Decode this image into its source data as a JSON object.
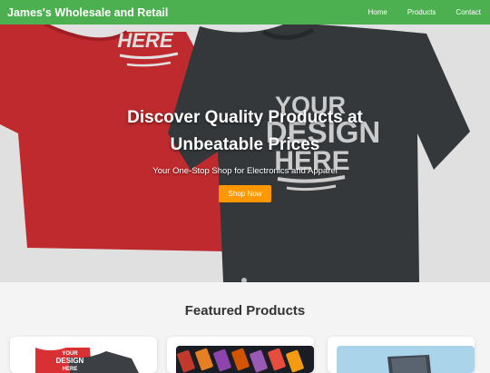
{
  "brand": "James's Wholesale and Retail",
  "nav": [
    {
      "label": "Home"
    },
    {
      "label": "Products"
    },
    {
      "label": "Contact"
    }
  ],
  "hero": {
    "title": "Discover Quality Products at Unbeatable Prices",
    "subtitle": "Your One-Stop Shop for Electronics and Apparel",
    "cta": "Shop Now",
    "shirt_print": [
      "YOUR",
      "DESIGN",
      "HERE"
    ],
    "carousel": {
      "slides": 1,
      "active": 1
    }
  },
  "featured": {
    "title": "Featured Products",
    "cards": [
      {
        "image": "tshirt-image",
        "print": [
          "YOUR",
          "DESIGN",
          "HERE"
        ]
      },
      {
        "image": "phones-image"
      },
      {
        "image": "laptop-image"
      }
    ]
  },
  "colors": {
    "navbar": "#4caf50",
    "cta": "#ff9800",
    "red_shirt": "#d93034",
    "gray_shirt": "#3c4044",
    "background": "#f4f4f4"
  }
}
